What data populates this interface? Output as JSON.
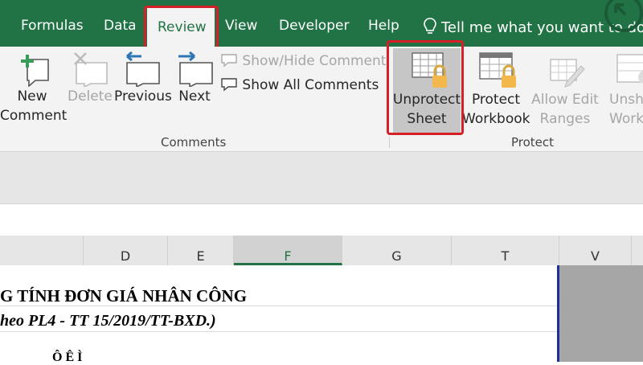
{
  "tabs": {
    "formulas": "Formulas",
    "data": "Data",
    "review": "Review",
    "view": "View",
    "developer": "Developer",
    "help": "Help",
    "tell_me": "Tell me what you want to do"
  },
  "ribbon": {
    "new_comment": [
      "New",
      "Comment"
    ],
    "delete": "Delete",
    "previous": "Previous",
    "next": "Next",
    "show_hide_comment": "Show/Hide Comment",
    "show_all_comments": "Show All Comments",
    "unprotect_sheet": [
      "Unprotect",
      "Sheet"
    ],
    "protect_workbook": [
      "Protect",
      "Workbook"
    ],
    "allow_edit_ranges": [
      "Allow Edit",
      "Ranges"
    ],
    "unshare_workbook": [
      "Unsha",
      "Workb"
    ],
    "group_comments": "Comments",
    "group_protect": "Protect"
  },
  "columns": [
    "D",
    "E",
    "F",
    "G",
    "T",
    "V"
  ],
  "selected_column": "F",
  "sheet": {
    "title": "G TÍNH ĐƠN GIÁ NHÂN CÔNG",
    "subtitle": "heo PL4 - TT 15/2019/TT-BXD.)",
    "partial_text": "Ô   Ê      Ì"
  },
  "colors": {
    "accent_green": "#217346",
    "highlight_red": "#d62027",
    "sheet_border_blue": "#1f2f9e"
  }
}
